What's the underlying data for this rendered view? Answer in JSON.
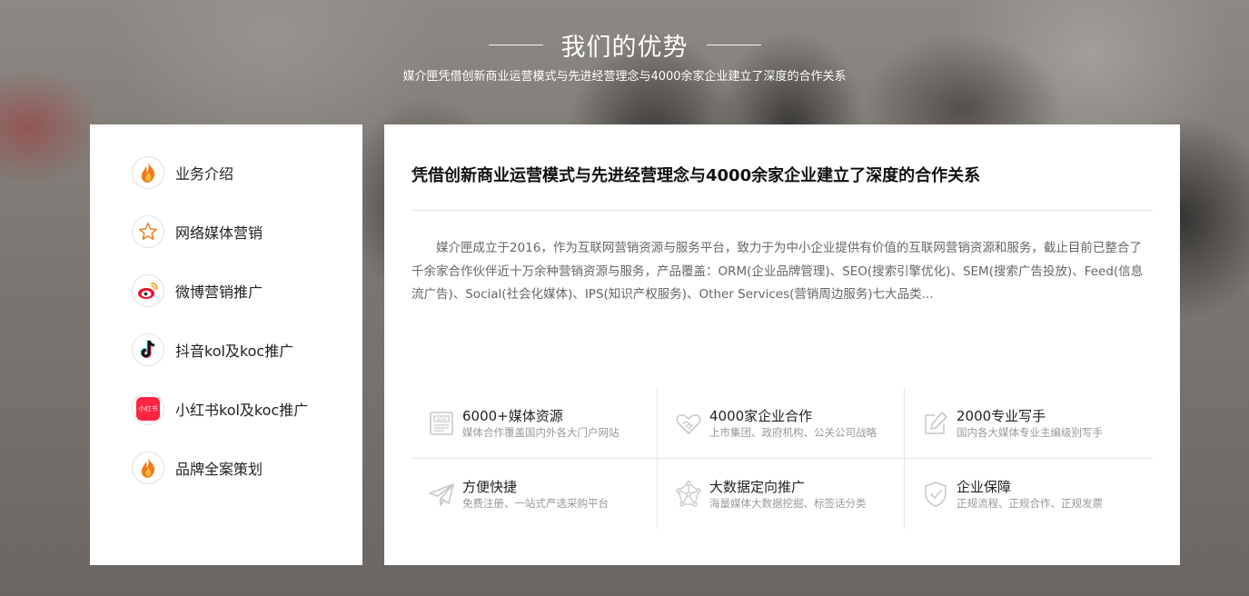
{
  "header": {
    "title": "我们的优势",
    "subtitle": "媒介匣凭借创新商业运营模式与先进经营理念与4000余家企业建立了深度的合作关系"
  },
  "menu": {
    "items": [
      {
        "label": "业务介绍",
        "icon": "flame-icon"
      },
      {
        "label": "网络媒体营销",
        "icon": "star-icon"
      },
      {
        "label": "微博营销推广",
        "icon": "weibo-icon"
      },
      {
        "label": "抖音kol及koc推广",
        "icon": "tiktok-icon"
      },
      {
        "label": "小红书kol及koc推广",
        "icon": "xiaohongshu-icon",
        "icon_text": "小红书"
      },
      {
        "label": "品牌全案策划",
        "icon": "flame-icon"
      }
    ]
  },
  "panel": {
    "title": "凭借创新商业运营模式与先进经营理念与4000余家企业建立了深度的合作关系",
    "description": "媒介匣成立于2016，作为互联网营销资源与服务平台，致力于为中小企业提供有价值的互联网营销资源和服务，截止目前已整合了千余家合作伙伴近十万余种营销资源与服务，产品覆盖：ORM(企业品牌管理)、SEO(搜索引擎优化)、SEM(搜索广告投放)、Feed(信息流广告)、Social(社会化媒体)、IPS(知识产权服务)、Other Services(营销周边服务)七大品类...",
    "features": [
      {
        "title": "6000+媒体资源",
        "subtitle": "媒体合作覆盖国内外各大门户网站",
        "icon": "newspaper-icon"
      },
      {
        "title": "4000家企业合作",
        "subtitle": "上市集团、政府机构、公关公司战略",
        "icon": "handshake-icon"
      },
      {
        "title": "2000专业写手",
        "subtitle": "国内各大媒体专业主编级别写手",
        "icon": "edit-icon"
      },
      {
        "title": "方便快捷",
        "subtitle": "免费注册、一站式严选采购平台",
        "icon": "paper-plane-icon"
      },
      {
        "title": "大数据定向推广",
        "subtitle": "海量媒体大数据挖掘、标签话分类",
        "icon": "network-icon"
      },
      {
        "title": "企业保障",
        "subtitle": "正规流程、正规合作、正规发票",
        "icon": "shield-icon"
      }
    ]
  },
  "colors": {
    "accent_orange": "#f07a1a",
    "weibo_red": "#e6162d",
    "xhs_red": "#ff2442"
  }
}
